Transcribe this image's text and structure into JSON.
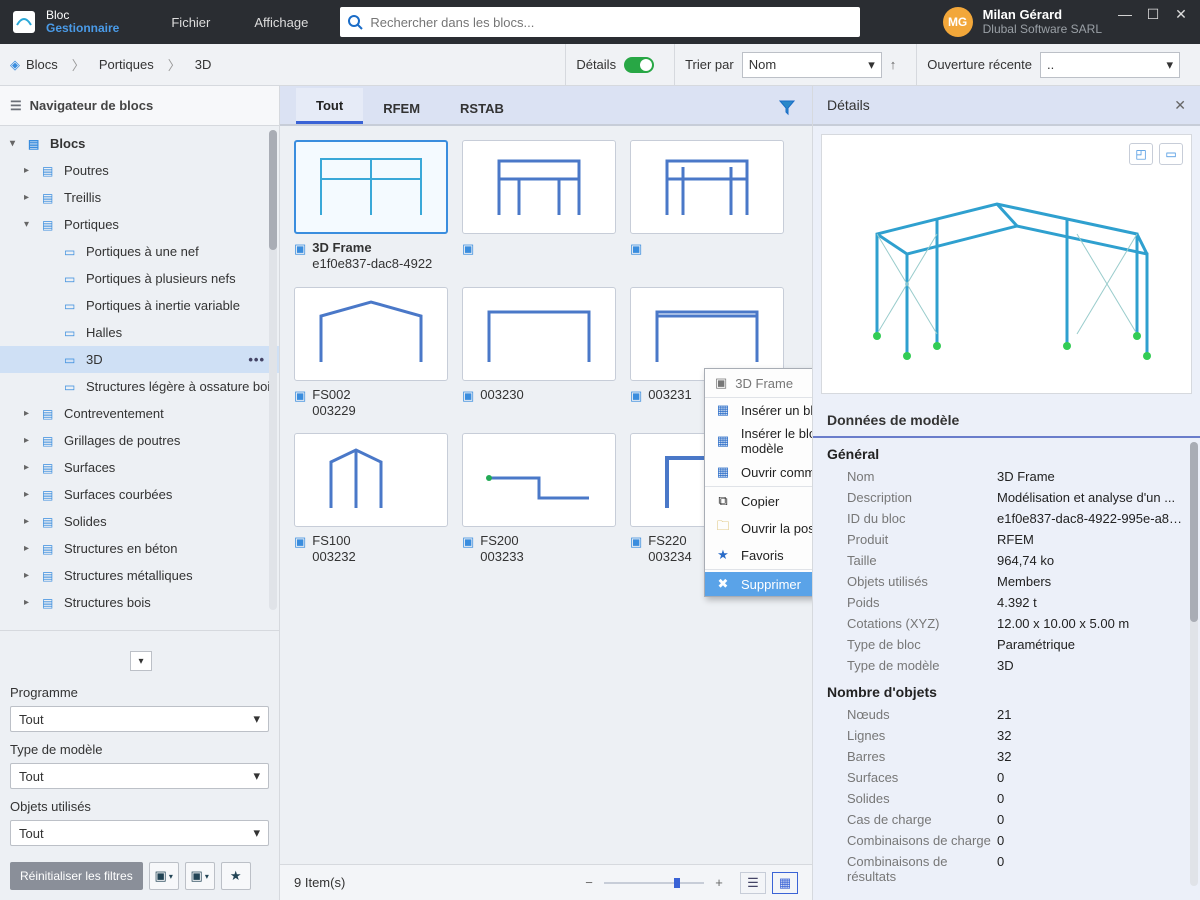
{
  "titlebar": {
    "brand1": "Bloc",
    "brand2": "Gestionnaire",
    "menus": [
      "Fichier",
      "Affichage"
    ],
    "search_placeholder": "Rechercher dans les blocs...",
    "user_initials": "MG",
    "user_name": "Milan Gérard",
    "user_company": "Dlubal Software SARL"
  },
  "crumb": {
    "root": "Blocs",
    "mid": "Portiques",
    "leaf": "3D"
  },
  "crumbright": {
    "details_label": "Détails",
    "sort_label": "Trier par",
    "sort_value": "Nom",
    "recent_label": "Ouverture récente",
    "recent_value": ".."
  },
  "sidebar": {
    "header": "Navigateur de blocs",
    "tree": {
      "root": "Blocs",
      "beams": "Poutres",
      "trusses": "Treillis",
      "frames": "Portiques",
      "frames_children": [
        "Portiques à une nef",
        "Portiques à plusieurs nefs",
        "Portiques à inertie variable",
        "Halles",
        "3D",
        "Structures légère à ossature bois"
      ],
      "others": [
        "Contreventement",
        "Grillages de poutres",
        "Surfaces",
        "Surfaces courbées",
        "Solides",
        "Structures en béton",
        "Structures métalliques",
        "Structures bois"
      ]
    },
    "filters": {
      "program_label": "Programme",
      "program_value": "Tout",
      "modeltype_label": "Type de modèle",
      "modeltype_value": "Tout",
      "usedobj_label": "Objets utilisés",
      "usedobj_value": "Tout",
      "reset": "Réinitialiser les filtres"
    }
  },
  "tabs": {
    "all": "Tout",
    "rfem": "RFEM",
    "rstab": "RSTAB"
  },
  "cards": [
    {
      "name": "3D Frame",
      "sub": "e1f0e837-dac8-4922",
      "sel": true,
      "bold": true
    },
    {
      "name": "",
      "sub": ""
    },
    {
      "name": "",
      "sub": ""
    },
    {
      "name": "FS002",
      "sub": "003229"
    },
    {
      "name": "",
      "sub": "003230"
    },
    {
      "name": "",
      "sub": "003231"
    },
    {
      "name": "FS100",
      "sub": "003232"
    },
    {
      "name": "FS200",
      "sub": "003233"
    },
    {
      "name": "FS220",
      "sub": "003234"
    }
  ],
  "context_menu": {
    "title": "3D Frame",
    "items": [
      "Insérer un bloc",
      "Insérer le bloc dans un nouveau modèle",
      "Ouvrir comme modèle",
      "Copier",
      "Ouvrir la position du fichier",
      "Favoris",
      "Supprimer"
    ]
  },
  "statusbar": {
    "count": "9 Item(s)"
  },
  "details": {
    "title": "Détails",
    "section": "Données de modèle",
    "group_general": "Général",
    "rows_general": [
      {
        "k": "Nom",
        "v": "3D Frame"
      },
      {
        "k": "Description",
        "v": "Modélisation et analyse d'un ..."
      },
      {
        "k": "ID du bloc",
        "v": "e1f0e837-dac8-4922-995e-a80..."
      },
      {
        "k": "Produit",
        "v": "RFEM"
      },
      {
        "k": "Taille",
        "v": "964,74 ko"
      },
      {
        "k": "Objets utilisés",
        "v": "Members"
      },
      {
        "k": "Poids",
        "v": "4.392 t"
      },
      {
        "k": "Cotations (XYZ)",
        "v": "12.00 x 10.00 x 5.00 m"
      },
      {
        "k": "Type de bloc",
        "v": "Paramétrique"
      },
      {
        "k": "Type de modèle",
        "v": "3D"
      }
    ],
    "group_objects": "Nombre d'objets",
    "rows_objects": [
      {
        "k": "Nœuds",
        "v": "21"
      },
      {
        "k": "Lignes",
        "v": "32"
      },
      {
        "k": "Barres",
        "v": "32"
      },
      {
        "k": "Surfaces",
        "v": "0"
      },
      {
        "k": "Solides",
        "v": "0"
      },
      {
        "k": "Cas de charge",
        "v": "0"
      },
      {
        "k": "Combinaisons de charge",
        "v": "0"
      },
      {
        "k": "Combinaisons de résultats",
        "v": "0"
      }
    ]
  }
}
